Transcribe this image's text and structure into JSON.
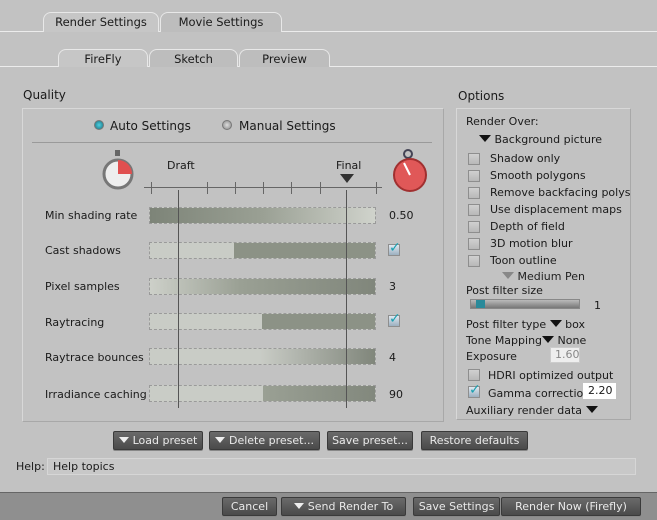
{
  "tabs": [
    {
      "label": "Render Settings",
      "active": true
    },
    {
      "label": "Movie Settings",
      "active": false
    }
  ],
  "subtabs": [
    {
      "label": "FireFly",
      "active": true
    },
    {
      "label": "Sketch",
      "active": false
    },
    {
      "label": "Preview",
      "active": false
    }
  ],
  "quality": {
    "title": "Quality",
    "mode_auto": "Auto Settings",
    "mode_manual": "Manual Settings",
    "selected_mode": "auto",
    "draft_label": "Draft",
    "final_label": "Final",
    "rows": [
      {
        "label": "Min shading rate",
        "value": "0.50"
      },
      {
        "label": "Cast shadows",
        "checked": true
      },
      {
        "label": "Pixel samples",
        "value": "3"
      },
      {
        "label": "Raytracing",
        "checked": true
      },
      {
        "label": "Raytrace bounces",
        "value": "4"
      },
      {
        "label": "Irradiance caching",
        "value": "90"
      }
    ]
  },
  "options": {
    "title": "Options",
    "render_over_label": "Render Over:",
    "render_over_value": "Background picture",
    "checkboxes": [
      {
        "label": "Shadow only",
        "checked": false
      },
      {
        "label": "Smooth polygons",
        "checked": false
      },
      {
        "label": "Remove backfacing polys",
        "checked": false
      },
      {
        "label": "Use displacement maps",
        "checked": false
      },
      {
        "label": "Depth of field",
        "checked": false
      },
      {
        "label": "3D motion blur",
        "checked": false
      },
      {
        "label": "Toon outline",
        "checked": false
      }
    ],
    "pen": "Medium Pen",
    "post_filter_size_label": "Post filter size",
    "post_filter_size": "1",
    "post_filter_type_label": "Post filter type",
    "post_filter_type": "box",
    "tone_mapping_label": "Tone Mapping",
    "tone_mapping": "None",
    "exposure_label": "Exposure",
    "exposure": "1.60",
    "hdri_label": "HDRI optimized output",
    "hdri_checked": false,
    "gamma_label": "Gamma correction",
    "gamma_checked": true,
    "gamma": "2.20",
    "aux_label": "Auxiliary render data"
  },
  "presets": {
    "load": "Load preset",
    "delete": "Delete preset...",
    "save": "Save preset...",
    "restore": "Restore defaults"
  },
  "help": {
    "label": "Help:",
    "value": "Help topics"
  },
  "footer": {
    "cancel": "Cancel",
    "send": "Send Render To",
    "save": "Save Settings",
    "render": "Render Now (Firefly)"
  }
}
